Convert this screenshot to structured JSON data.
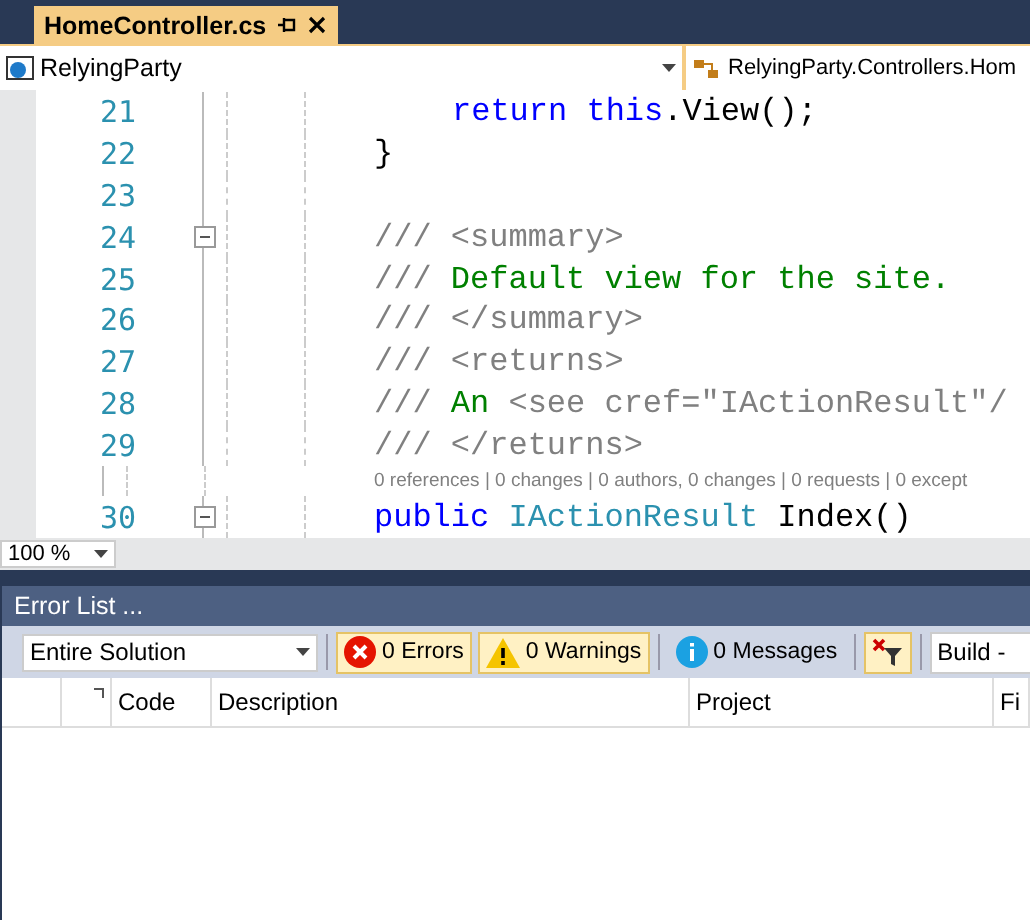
{
  "tabs": [
    {
      "label": "HomeController.cs",
      "selected": true
    }
  ],
  "nav": {
    "project": "RelyingParty",
    "type": "RelyingParty.Controllers.Hom"
  },
  "editor": {
    "lines": [
      {
        "kind": "code",
        "number": "21",
        "nested": true,
        "fold": false,
        "tokens": [
          {
            "kind": "keyword",
            "text": "return this"
          },
          {
            "kind": "plain",
            "text": ".View();"
          }
        ]
      },
      {
        "kind": "code",
        "number": "22",
        "nested": false,
        "fold": false,
        "tokens": [
          {
            "kind": "plain",
            "text": "}"
          }
        ]
      },
      {
        "kind": "code",
        "number": "23",
        "fold": false
      },
      {
        "kind": "code",
        "number": "24",
        "nested": false,
        "fold": true,
        "tokens": [
          {
            "kind": "doc",
            "text": "/// <summary>"
          }
        ]
      },
      {
        "kind": "code",
        "number": "25",
        "nested": false,
        "fold": false,
        "tokens": [
          {
            "kind": "doc",
            "text": "/// "
          },
          {
            "kind": "comment",
            "text": "Default view for the site."
          }
        ]
      },
      {
        "kind": "code",
        "number": "26",
        "nested": false,
        "fold": false,
        "tokens": [
          {
            "kind": "doc",
            "text": "/// </summary>"
          }
        ]
      },
      {
        "kind": "code",
        "number": "27",
        "nested": false,
        "fold": false,
        "tokens": [
          {
            "kind": "doc",
            "text": "/// <returns>"
          }
        ]
      },
      {
        "kind": "code",
        "number": "28",
        "nested": false,
        "fold": false,
        "tokens": [
          {
            "kind": "doc",
            "text": "/// "
          },
          {
            "kind": "comment",
            "text": "An "
          },
          {
            "kind": "doc",
            "text": "<see cref=\"IActionResult\"/"
          }
        ]
      },
      {
        "kind": "code",
        "number": "29",
        "nested": false,
        "fold": false,
        "tokens": [
          {
            "kind": "doc",
            "text": "/// </returns>"
          }
        ]
      },
      {
        "kind": "lens",
        "text": "0 references | 0 changes | 0 authors, 0 changes | 0 requests | 0 except"
      },
      {
        "kind": "code",
        "number": "30",
        "nested": false,
        "fold": true,
        "tokens": [
          {
            "kind": "keyword",
            "text": "public "
          },
          {
            "kind": "type",
            "text": "IActionResult"
          },
          {
            "kind": "plain",
            "text": " Index()"
          }
        ]
      }
    ],
    "zoom": "100 %"
  },
  "error_list": {
    "title": "Error List ...",
    "scope": "Entire Solution",
    "filters": [
      {
        "kind": "errors",
        "label": "0 Errors",
        "pressed": true
      },
      {
        "kind": "warnings",
        "label": "0 Warnings",
        "pressed": true
      },
      {
        "kind": "messages",
        "label": "0 Messages",
        "pressed": false
      },
      {
        "kind": "clear",
        "pressed": true
      }
    ],
    "source": "Build -",
    "columns": [
      "Code",
      "Description",
      "Project",
      "Fi"
    ]
  }
}
